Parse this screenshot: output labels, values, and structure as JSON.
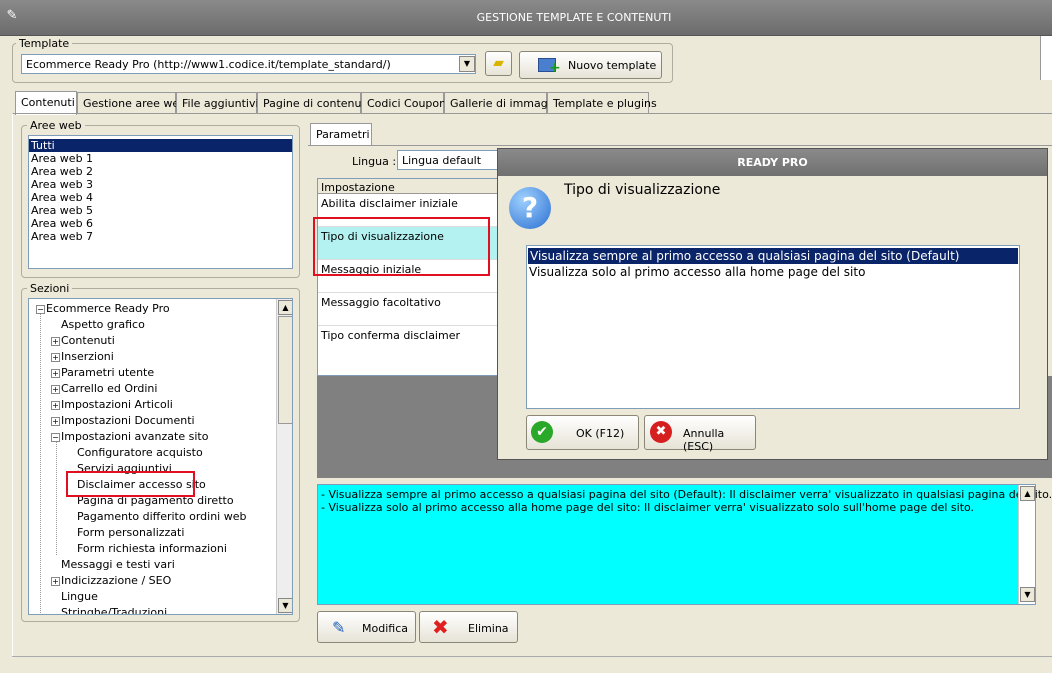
{
  "window": {
    "title": "GESTIONE TEMPLATE E CONTENUTI"
  },
  "template_group": {
    "legend": "Template",
    "selected": "Ecommerce Ready Pro (http://www1.codice.it/template_standard/)",
    "new_button": "Nuovo template"
  },
  "tabs": [
    {
      "label": "Contenuti",
      "active": true
    },
    {
      "label": "Gestione aree web"
    },
    {
      "label": "File aggiuntivi"
    },
    {
      "label": "Pagine di contenuti"
    },
    {
      "label": "Codici Coupon"
    },
    {
      "label": "Gallerie di immagini"
    },
    {
      "label": "Template e plugins"
    }
  ],
  "aree_web": {
    "legend": "Aree web",
    "items": [
      "Tutti",
      "Area web 1",
      "Area web 2",
      "Area web 3",
      "Area web 4",
      "Area web 5",
      "Area web 6",
      "Area web 7"
    ],
    "selected_index": 0
  },
  "sezioni": {
    "legend": "Sezioni",
    "root": "Ecommerce Ready Pro",
    "items": [
      "Aspetto grafico",
      "Contenuti",
      "Inserzioni",
      "Parametri utente",
      "Carrello ed Ordini",
      "Impostazioni Articoli",
      "Impostazioni Documenti",
      "Impostazioni avanzate sito",
      "Configuratore acquisto",
      "Servizi aggiuntivi",
      "Disclaimer accesso sito",
      "Pagina di pagamento diretto",
      "Pagamento differito ordini web",
      "Form personalizzati",
      "Form richiesta informazioni",
      "Messaggi e testi vari",
      "Indicizzazione / SEO",
      "Lingue",
      "Stringhe/Traduzioni"
    ]
  },
  "parametri": {
    "tab": "Parametri",
    "lingua_label": "Lingua :",
    "lingua_value": "Lingua default",
    "column_header": "Impostazione",
    "rows": [
      "Abilita disclaimer iniziale",
      "Tipo di visualizzazione",
      "Messaggio iniziale",
      "Messaggio facoltativo",
      "Tipo conferma disclaimer"
    ]
  },
  "description": {
    "line1": "- Visualizza sempre al primo accesso a qualsiasi pagina del sito (Default): Il disclaimer verra' visualizzato in qualsiasi pagina del sito.",
    "line2": "- Visualizza solo al primo accesso alla home page del sito: Il disclaimer verra' visualizzato solo sull'home page del sito."
  },
  "buttons": {
    "modifica": "Modifica",
    "elimina": "Elimina"
  },
  "dialog": {
    "title": "READY PRO",
    "heading": "Tipo di visualizzazione",
    "options": [
      "Visualizza sempre al primo accesso a qualsiasi pagina del sito (Default)",
      "Visualizza solo al primo accesso alla home page del sito"
    ],
    "selected_index": 0,
    "ok": "OK (F12)",
    "cancel": "Annulla (ESC)"
  },
  "colors": {
    "accent": "#0a246a",
    "highlight_row": "#b4f2f2",
    "description_bg": "#00ffff",
    "annotation": "#e01020"
  }
}
